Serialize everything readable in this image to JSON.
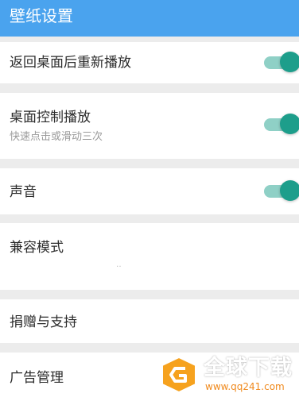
{
  "header": {
    "title": "壁纸设置"
  },
  "settings": {
    "replay_after_return": {
      "label": "返回桌面后重新播放",
      "enabled": true
    },
    "desktop_control": {
      "label": "桌面控制播放",
      "sublabel": "快速点击或滑动三次",
      "enabled": true
    },
    "sound": {
      "label": "声音",
      "enabled": true
    },
    "compat_mode": {
      "label": "兼容模式"
    },
    "donate": {
      "label": "捐赠与支持"
    },
    "ads": {
      "label": "广告管理"
    }
  },
  "watermark": {
    "brand": "全球下载",
    "url": "www.qq241.com"
  },
  "colors": {
    "header_bg": "#4aa3ee",
    "toggle_on": "#1d9e8b",
    "watermark_accent": "#f08a1e"
  },
  "icons": {
    "toggle": "switch-toggle-icon",
    "logo": "download-logo-icon"
  }
}
